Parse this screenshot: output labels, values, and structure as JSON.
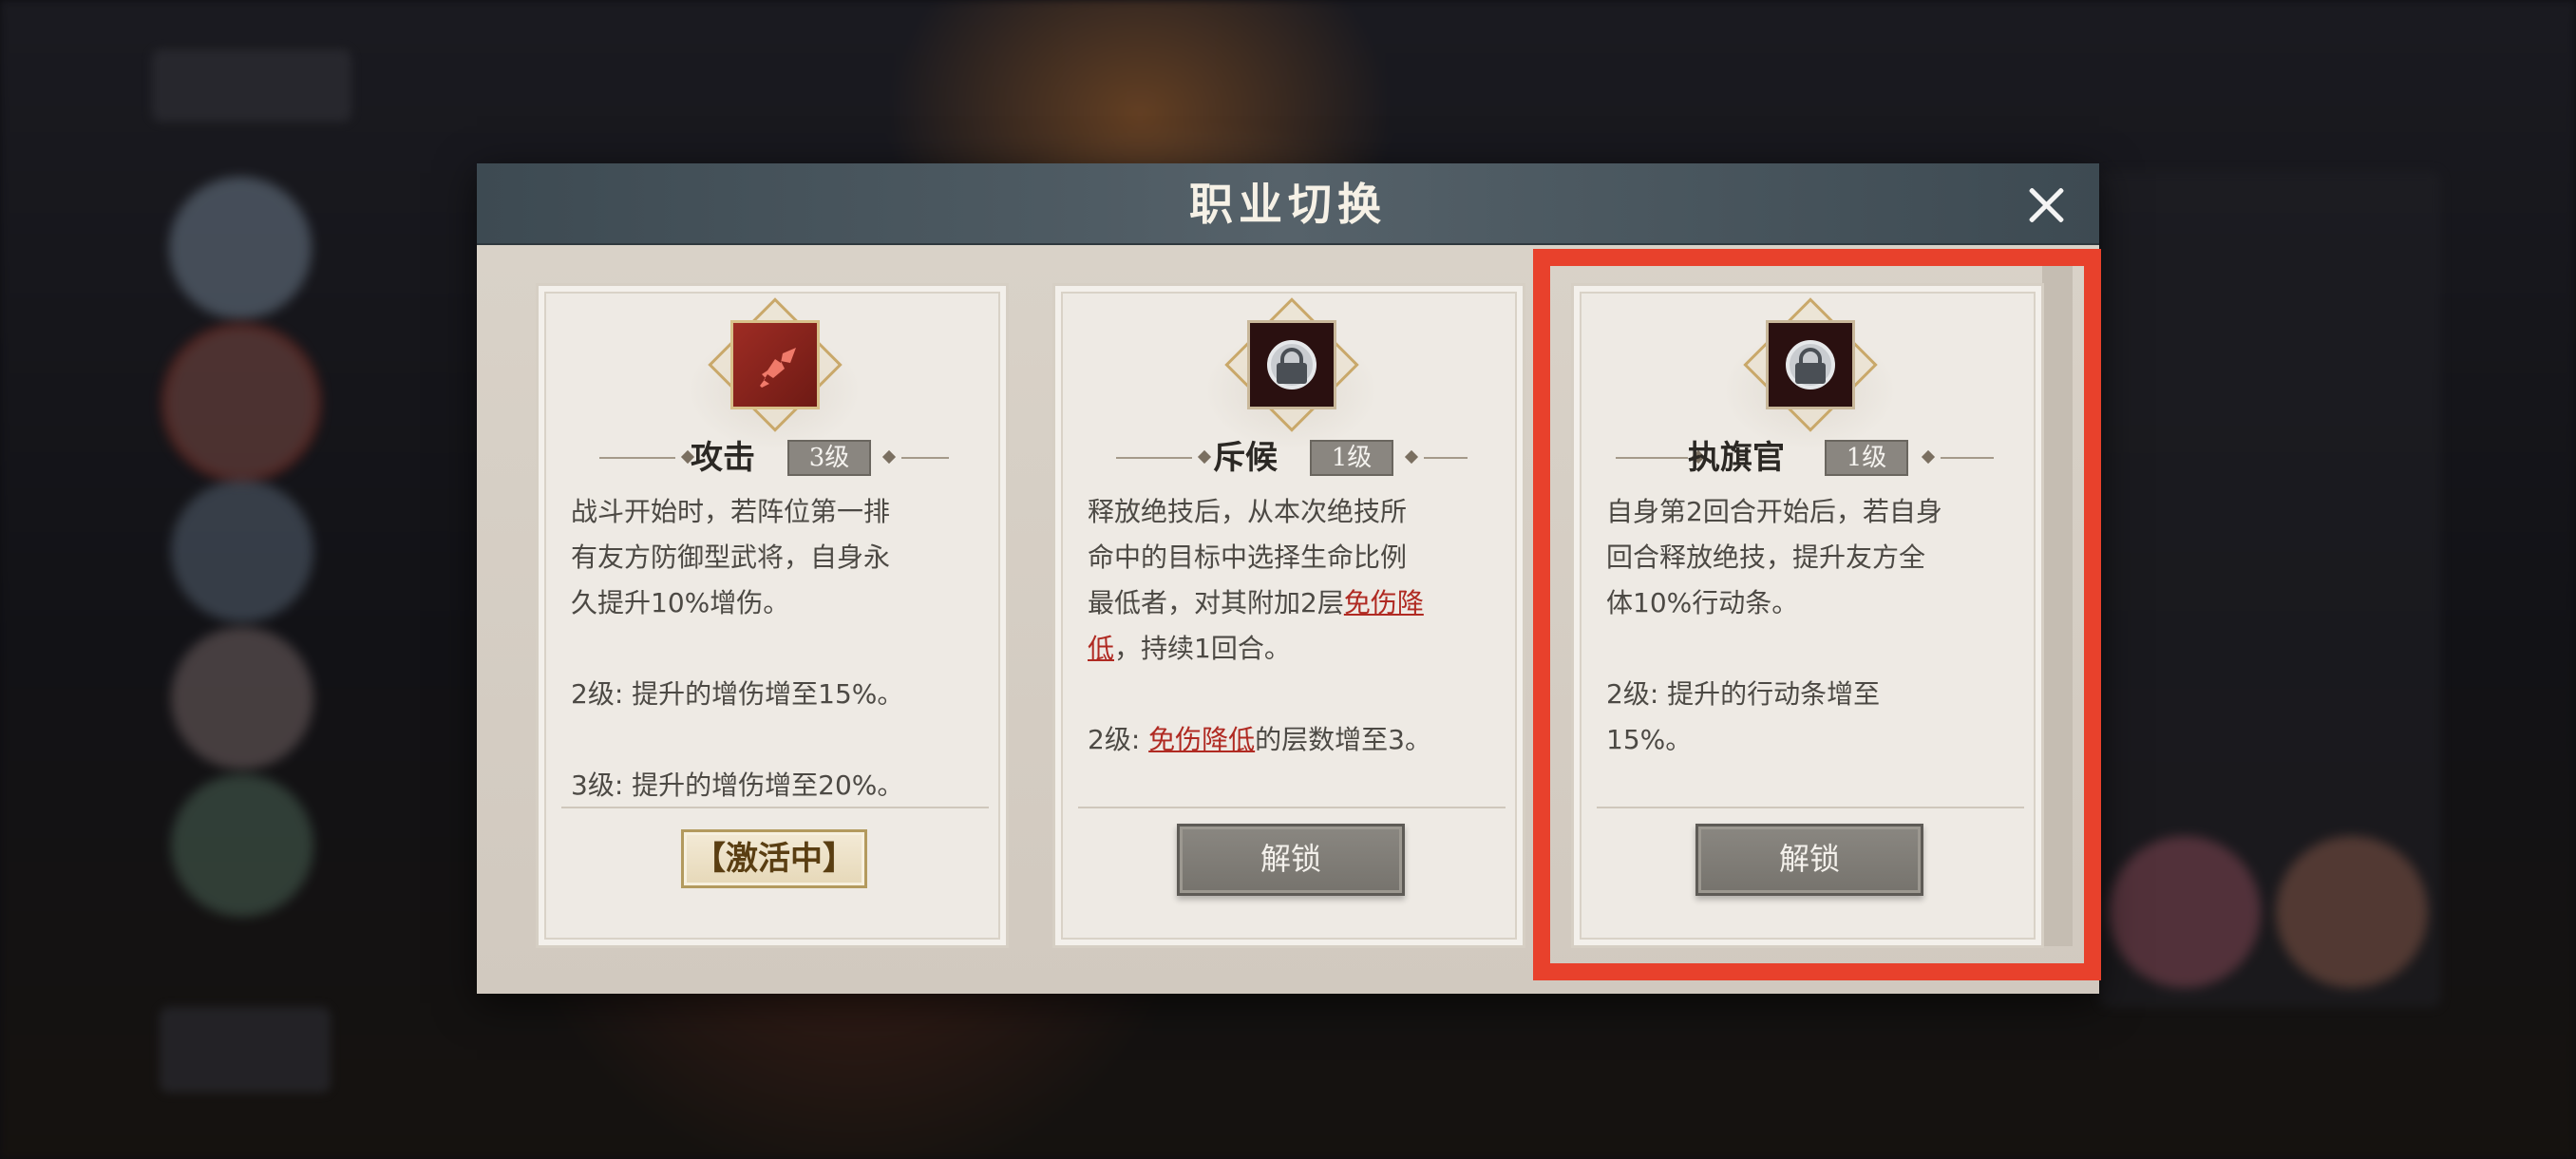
{
  "dialog": {
    "title": "职业切换",
    "close_icon": "close-icon"
  },
  "cards": [
    {
      "icon": "sword-icon",
      "name": "攻击",
      "level": "3级",
      "description": "战斗开始时，若阵位第一排\n有友方防御型武将，自身永\n久提升10%增伤。\n\n2级: 提升的增伤增至15%。\n\n3级: 提升的增伤增至20%。",
      "status": "【激活中】"
    },
    {
      "icon": "lock-icon",
      "name": "斥候",
      "level": "1级",
      "desc_parts": {
        "p1": "释放绝技后，从本次绝技所\n命中的目标中选择生命比例\n最低者，对其附加2层",
        "hl1": "免伤降\n低",
        "p2": "，持续1回合。\n\n2级: ",
        "hl2": "免伤降低",
        "p3": "的层数增至3。"
      },
      "button": "解锁"
    },
    {
      "icon": "lock-icon",
      "name": "执旗官",
      "level": "1级",
      "description": "自身第2回合开始后，若自身\n回合释放绝技，提升友方全\n体10%行动条。\n\n2级: 提升的行动条增至\n15%。",
      "button": "解锁"
    }
  ],
  "colors": {
    "highlight": "#e8412c",
    "header": "#4d5a62",
    "highlight_text": "#b02a22"
  }
}
